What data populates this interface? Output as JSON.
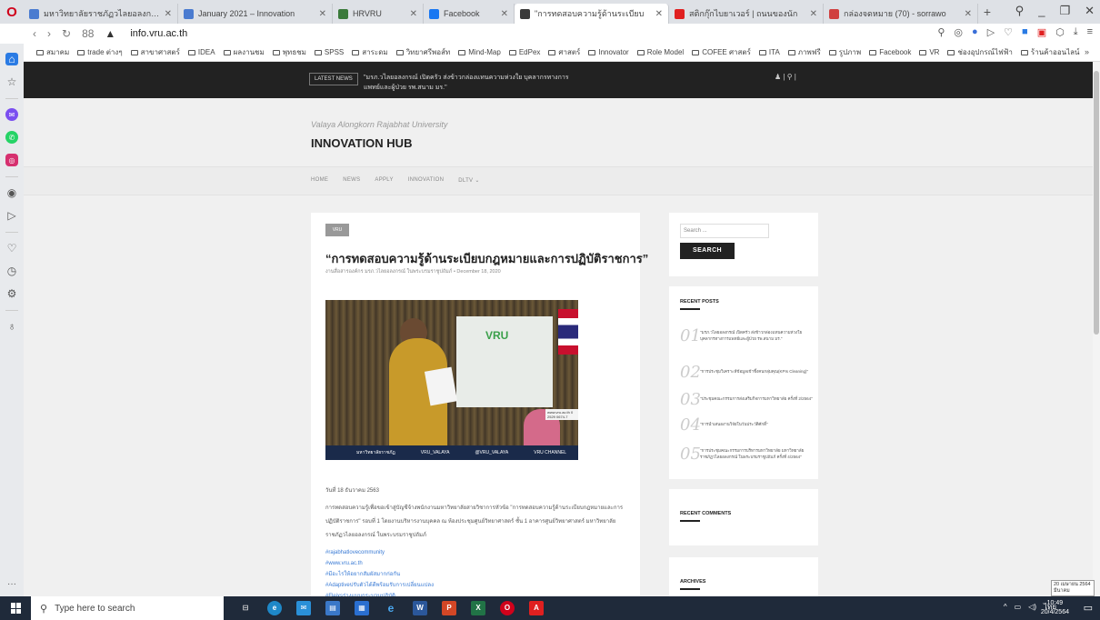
{
  "browser": {
    "tabs": [
      {
        "label": "มหาวิทยาลัยราชภัฏวไลยอลงกรณ์",
        "color": "#4a7bd0"
      },
      {
        "label": "January 2021 – Innovation",
        "color": "#4a7bd0"
      },
      {
        "label": "HRVRU",
        "color": "#3a7a3a"
      },
      {
        "label": "Facebook",
        "color": "#1877f2"
      },
      {
        "label": "\"การทดสอบความรู้ด้านระเบียบ",
        "color": "#3a3a3a",
        "active": true
      },
      {
        "label": "สติกกุ๊กไบยาเวอร์ | ถนนของนัก",
        "color": "#e02020"
      },
      {
        "label": "กล่องจดหมาย (70) - sorrawo",
        "color": "#d04040"
      }
    ],
    "new_tab": "+",
    "url": "info.vru.ac.th",
    "speed_dial": "88",
    "bookmarks": [
      "สมาคม",
      "trade ต่างๆ",
      "สาขาศาสตร์",
      "IDEA",
      "ผลงานชม",
      "พุทธชม",
      "SPSS",
      "สาระดม",
      "วิทยาศรีพอส์ท",
      "Mind-Map",
      "EdPex",
      "ศาสตร์",
      "Innovator",
      "Role Model",
      "COFEE ศาสตร์",
      "ITA",
      "ภาพฟรี",
      "รูปภาพ",
      "Facebook",
      "VR",
      "ช่องอุปกรณ์ไฟฟ้า",
      "ร้านค้าออนไลน์"
    ],
    "bookmarks_more": "»"
  },
  "site": {
    "latest_label": "LATEST NEWS",
    "latest_text": "\"มรภ.วไลยอลงกรณ์ เปิดครัว ส่งข้าวกล่องแทนความห่วงใย บุคลากรทางการแพทย์และผู้ป่วย รพ.สนาม มร.\"",
    "tagline": "Valaya Alongkorn Rajabhat University",
    "title": "INNOVATION HUB",
    "menu": [
      "HOME",
      "NEWS",
      "APPLY",
      "INNOVATION",
      "DLTV ⌄"
    ]
  },
  "article": {
    "category": "VRU",
    "title": "“การทดสอบความรู้ด้านระเบียบกฎหมายและการปฏิบัติราชการ”",
    "meta": "งานสื่อสารองค์กร มรภ.วไลยอลงกรณ์ ในพระบรมราชูปถัมภ์ • December 18, 2020",
    "photo_brand": "VRU",
    "photo_social": [
      "มหาวิทยาลัยราชภัฏ",
      "VRU_VALAYA",
      "@VRU_VALAYA",
      "VRU CHANNEL"
    ],
    "photo_phone": "www.vru.ac.th 0 2529 0674-7",
    "date": "วันที่ 18 ธันวาคม 2563",
    "body": "การทดสอบความรู้เพื่อขอเข้าสู่บัญชีจ้างพนักงานมหาวิทยาลัยสายวิชาการหัวข้อ \"การทดสอบความรู้ด้านระเบียบกฎหมายและการปฏิบัติราชการ\" รอบที่ 1 โดยงานบริหารงานบุคคล ณ ห้องประชุมศูนย์วิทยาศาสตร์ ชั้น 1 อาคารศูนย์วิทยาศาสตร์ มหาวิทยาลัยราชภัฏวไลยอลงกรณ์ ในพระบรมราชูปถัมภ์",
    "hashtags": [
      "#rajabhatlovecommunity",
      "#www.vru.ac.th",
      "#มีอะไรให้อยากสัมผัสมากก่อกัน",
      "#Adaptiveปรับตัวได้ดีพร้อมรับการเปลี่ยนแปลง",
      "#Fleixsร่างแบบกระบวนปฏิบัติ"
    ]
  },
  "widgets": {
    "search_placeholder": "Search ...",
    "search_button": "SEARCH",
    "recent_title": "RECENT POSTS",
    "recent_posts": [
      {
        "num": "01",
        "text": "\"มรภ.วไลยอลงกรณ์ เปิดครัว ส่งข้าวกล่องแทนความห่วงใย บุคลากรทางการแพทย์และผู้ป่วย รพ.สนาม มร.\""
      },
      {
        "num": "02",
        "text": "\"การประชุมวิเคราะห์ข้อมูลเข้าชิ้งคนกลุ่มคุณ(KPIs Cleaning)\""
      },
      {
        "num": "03",
        "text": "\"ประชุมคณะกรรมการส่งเสริมกิจการมหาวิทยาลัย ครั้งที่ 2/2564\""
      },
      {
        "num": "04",
        "text": "\"การนำเสนองานวิจัยในวันประวัติศักดิ์\""
      },
      {
        "num": "05",
        "text": "\"การประชุมคณะกรรมการบริหารมหาวิทยาลัย มหาวิทยาลัยราชภัฏวไลยอลงกรณ์ ในพระบรมราชูปถัมภ์ ครั้งที่ 4/2564\""
      }
    ],
    "comments_title": "RECENT COMMENTS",
    "archives_title": "ARCHIVES"
  },
  "tooltip": "20 เมษายน 2564 มีนาคม",
  "taskbar": {
    "search_placeholder": "Type here to search",
    "lang": "ไทย",
    "time": "10:49",
    "date": "20/4/2564"
  }
}
